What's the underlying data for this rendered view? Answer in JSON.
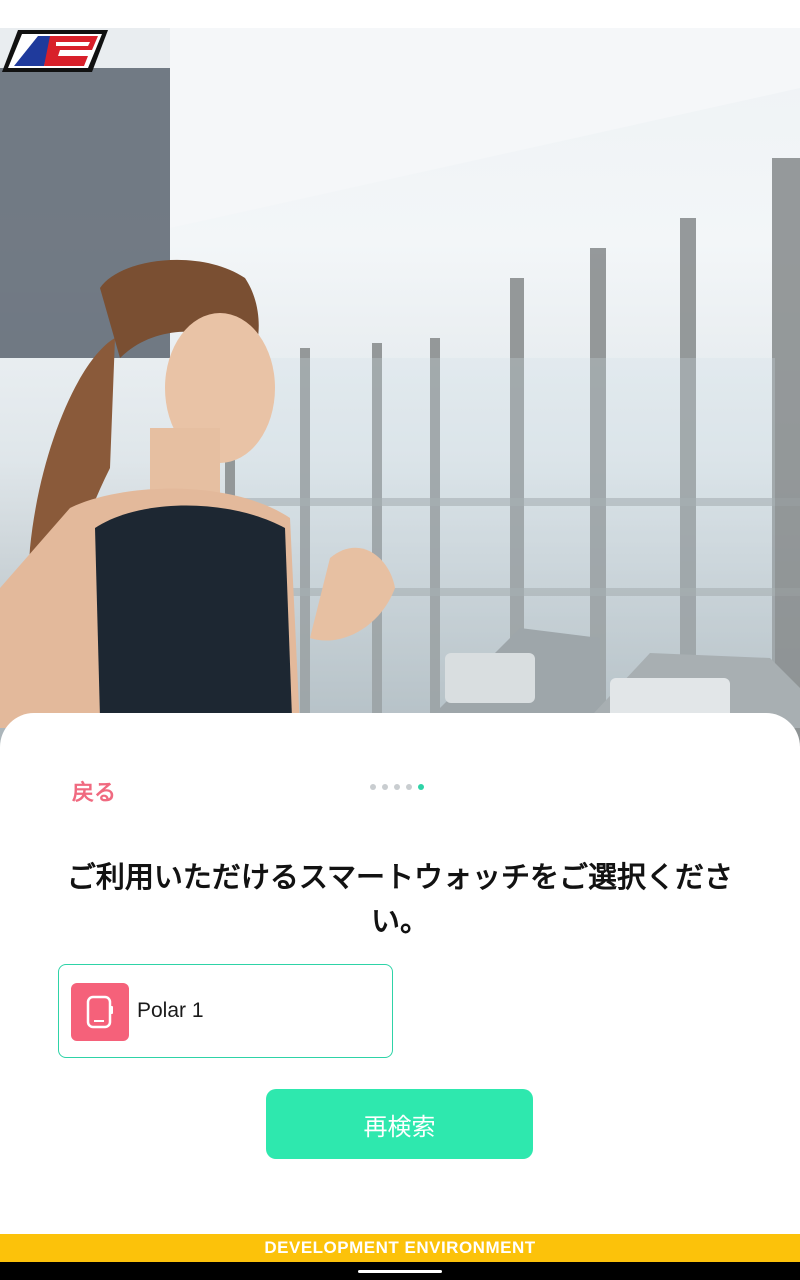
{
  "app": {
    "logo_text": "AS"
  },
  "hero": {
    "image_icon": "hero-photo"
  },
  "sheet": {
    "back_label": "戻る",
    "pager": {
      "total": 5,
      "active_index": 4
    },
    "title": "ご利用いただけるスマートウォッチをご選択ください。",
    "devices": [
      {
        "name": "Polar 1",
        "icon": "watch-icon"
      }
    ],
    "rescan_label": "再検索"
  },
  "banner": {
    "text": "DEVELOPMENT ENVIRONMENT"
  },
  "colors": {
    "accent": "#2ee8ae",
    "accent_border": "#2ed3a7",
    "back_link": "#f06a80",
    "device_icon_bg": "#f5617a",
    "banner": "#fcc20a"
  }
}
